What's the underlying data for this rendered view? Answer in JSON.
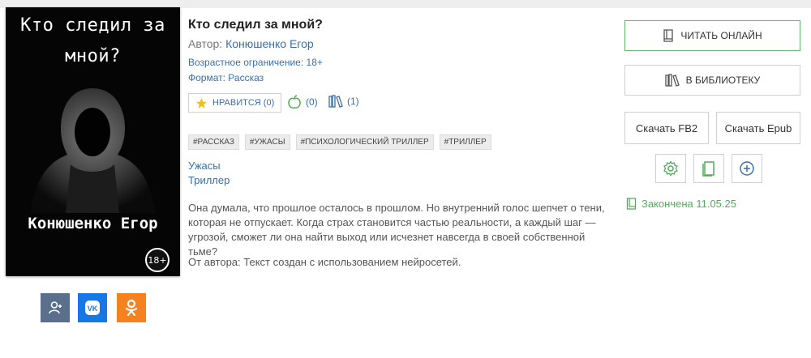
{
  "cover": {
    "title_line1": "Кто следил за",
    "title_line2": "мной?",
    "author": "Конюшенко Егор",
    "age_badge": "18+"
  },
  "book": {
    "title": "Кто следил за мной?",
    "author_label": "Автор: ",
    "author_name": "Конюшенко Егор",
    "age_restriction": "Возрастное ограничение: 18+",
    "format": "Формат: Рассказ",
    "like_label": "НРАВИТСЯ (0)",
    "apple_count": "(0)",
    "library_count": "(1)",
    "tags": [
      "#РАССКАЗ",
      "#УЖАСЫ",
      "#ПСИХОЛОГИЧЕСКИЙ ТРИЛЛЕР",
      "#ТРИЛЛЕР"
    ],
    "genres": [
      "Ужасы",
      "Триллер"
    ],
    "description": "Она думала, что прошлое осталось в прошлом. Но внутренний голос шепчет о тени, которая не отпускает. Когда страх становится частью реальности, а каждый шаг — угрозой, сможет ли она найти выход или исчезнет навсегда в своей собственной тьме?",
    "from_author": "От автора: Текст создан с использованием нейросетей."
  },
  "actions": {
    "read_online": "ЧИТАТЬ ОНЛАЙН",
    "to_library": "В БИБЛИОТЕКУ",
    "download_fb2": "Скачать FB2",
    "download_epub": "Скачать Epub",
    "status": "Закончена 11.05.25"
  },
  "colors": {
    "link": "#3a6fa8",
    "accent_green": "#4fae59",
    "star": "#f2c012",
    "vk": "#1877e6",
    "ok": "#f58220",
    "user": "#5a6f8c"
  },
  "icons": {
    "star": "star-icon",
    "apple": "apple-icon",
    "books": "books-icon",
    "book": "book-icon",
    "gear": "gear-icon",
    "plus": "plus-icon",
    "vk": "vk-icon",
    "ok": "ok-icon",
    "user": "user-add-icon"
  }
}
